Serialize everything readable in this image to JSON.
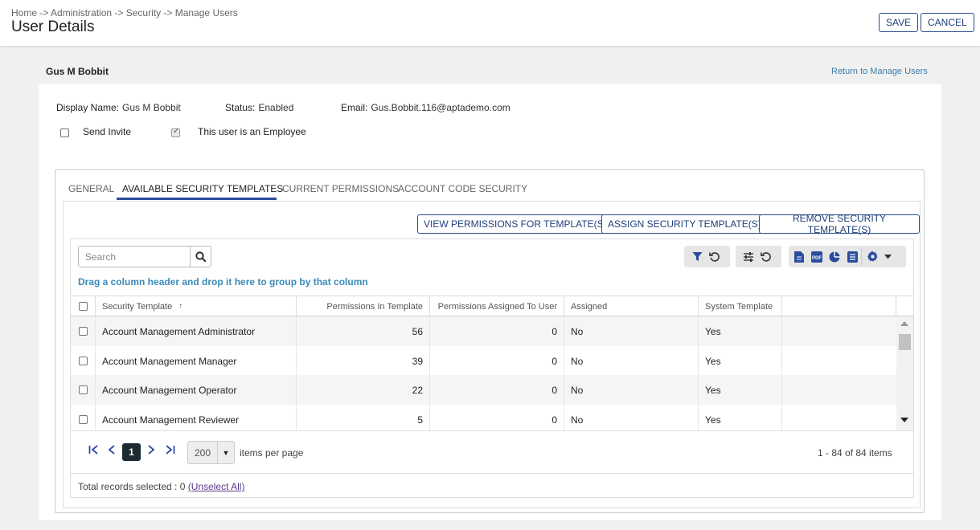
{
  "header": {
    "breadcrumb": "Home -> Administration -> Security -> Manage Users",
    "title": "User Details",
    "save_label": "SAVE",
    "cancel_label": "CANCEL"
  },
  "user": {
    "name": "Gus M Bobbit",
    "return_link": "Return to Manage Users",
    "display_name_label": "Display Name:",
    "display_name": "Gus M Bobbit",
    "status_label": "Status:",
    "status": "Enabled",
    "email_label": "Email:",
    "email": "Gus.Bobbit.116@aptademo.com",
    "send_invite_label": "Send Invite",
    "send_invite_checked": false,
    "employee_label": "This user is an Employee",
    "employee_checked": true
  },
  "tabs": [
    {
      "label": "General"
    },
    {
      "label": "Available Security Templates"
    },
    {
      "label": "Current Permissions"
    },
    {
      "label": "Account Code Security"
    }
  ],
  "actions": {
    "view_permissions": "View Permissions for Template(s)",
    "assign": "Assign Security Template(s)",
    "remove": "Remove Security Template(s)"
  },
  "grid": {
    "search_placeholder": "Search",
    "group_hint": "Drag a column header and drop it here to group by that column",
    "columns": {
      "security_template": "Security Template",
      "sort_indicator": "↑",
      "permissions_in_template": "Permissions In Template",
      "permissions_assigned": "Permissions Assigned To User",
      "assigned": "Assigned",
      "system_template": "System Template"
    },
    "rows": [
      {
        "template": "Account Management Administrator",
        "perms": "56",
        "assigned_count": "0",
        "assigned": "No",
        "system": "Yes"
      },
      {
        "template": "Account Management Manager",
        "perms": "39",
        "assigned_count": "0",
        "assigned": "No",
        "system": "Yes"
      },
      {
        "template": "Account Management Operator",
        "perms": "22",
        "assigned_count": "0",
        "assigned": "No",
        "system": "Yes"
      },
      {
        "template": "Account Management Reviewer",
        "perms": "5",
        "assigned_count": "0",
        "assigned": "No",
        "system": "Yes"
      }
    ]
  },
  "pager": {
    "current_page": "1",
    "page_size": "200",
    "items_per_page_label": "items per page",
    "info": "1 - 84 of 84 items"
  },
  "footer": {
    "selected_text": "Total records selected : 0",
    "unselect_label": "(Unselect All)"
  }
}
